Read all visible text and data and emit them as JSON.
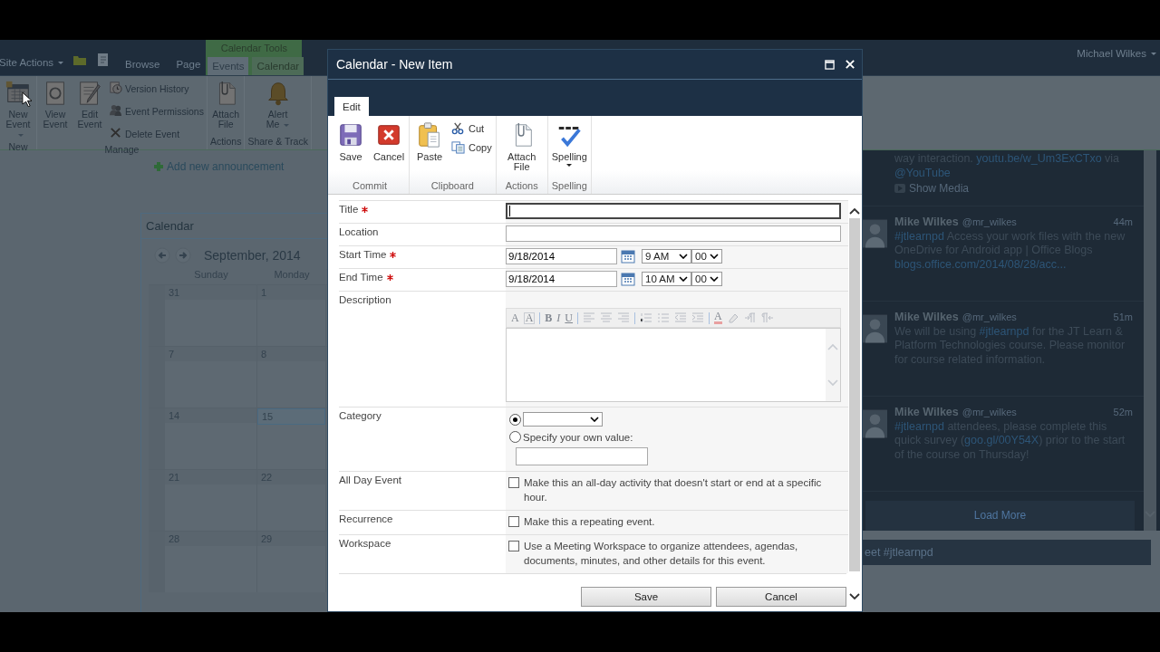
{
  "top_bar": {
    "site_actions": "Site Actions",
    "tabs": [
      {
        "label": "Browse",
        "selected": false
      },
      {
        "label": "Page",
        "selected": false
      }
    ],
    "tool_group": {
      "title": "Calendar Tools",
      "tabs": [
        {
          "label": "Events",
          "selected": true
        },
        {
          "label": "Calendar",
          "selected": false
        }
      ]
    },
    "user": "Michael Wilkes"
  },
  "page_ribbon": {
    "groups": [
      {
        "label": "New",
        "items": [
          {
            "kind": "large",
            "label": "New Event",
            "dropdown": true
          }
        ]
      },
      {
        "label": "Manage",
        "items": [
          {
            "kind": "large",
            "label": "View Event",
            "dropdown": false
          },
          {
            "kind": "large",
            "label": "Edit Event",
            "dropdown": false
          },
          {
            "kind": "stack",
            "items": [
              "Version History",
              "Event Permissions",
              "Delete Event"
            ]
          }
        ]
      },
      {
        "label": "Actions",
        "items": [
          {
            "kind": "large",
            "label": "Attach File",
            "dropdown": false
          }
        ]
      },
      {
        "label": "Share & Track",
        "items": [
          {
            "kind": "large",
            "label": "Alert Me",
            "dropdown": true
          }
        ]
      }
    ]
  },
  "content": {
    "add_link": "Add new announcement",
    "calendar": {
      "title": "Calendar",
      "month": "September, 2014",
      "days": [
        "Sunday",
        "Monday"
      ],
      "weeks": [
        [
          {
            "date": "31",
            "today": false
          },
          {
            "date": "1",
            "today": false
          }
        ],
        [
          {
            "date": "7",
            "today": false
          },
          {
            "date": "8",
            "today": false
          }
        ],
        [
          {
            "date": "14",
            "today": false
          },
          {
            "date": "15",
            "today": true
          }
        ],
        [
          {
            "date": "21",
            "today": false
          },
          {
            "date": "22",
            "today": false
          }
        ],
        [
          {
            "date": "28",
            "today": false
          },
          {
            "date": "29",
            "today": false
          }
        ]
      ]
    }
  },
  "twitter": {
    "partial_tweet": {
      "segments": [
        {
          "kind": "plain",
          "text": "way interaction. "
        },
        {
          "kind": "link",
          "text": "youtu.be/w_Um3ExCTxo"
        },
        {
          "kind": "plain",
          "text": " via "
        },
        {
          "kind": "link",
          "text": "@YouTube"
        }
      ],
      "media": "Show Media"
    },
    "tweets": [
      {
        "name": "Mike Wilkes",
        "handle": "@mr_wilkes",
        "time": "44m",
        "segments": [
          {
            "kind": "link",
            "text": "#jtlearnpd"
          },
          {
            "kind": "plain",
            "text": " Access your work files with the new OneDrive for Android app | Office Blogs "
          },
          {
            "kind": "link",
            "text": "blogs.office.com/2014/08/28/acc..."
          }
        ]
      },
      {
        "name": "Mike Wilkes",
        "handle": "@mr_wilkes",
        "time": "51m",
        "segments": [
          {
            "kind": "plain",
            "text": "We will be using "
          },
          {
            "kind": "link",
            "text": "#jtlearnpd"
          },
          {
            "kind": "plain",
            "text": " for the JT Learn & Platform Technologies course. Please monitor for course related information."
          }
        ]
      },
      {
        "name": "Mike Wilkes",
        "handle": "@mr_wilkes",
        "time": "52m",
        "segments": [
          {
            "kind": "link",
            "text": "#jtlearnpd"
          },
          {
            "kind": "plain",
            "text": " attendees, please complete this quick survey ("
          },
          {
            "kind": "link",
            "text": "goo.gl/00Y54X"
          },
          {
            "kind": "plain",
            "text": ") prior to the start of the course on Thursday!"
          }
        ]
      }
    ],
    "load_more": "Load More",
    "compose": {
      "placeholder": "eet #jtlearnpd"
    }
  },
  "dialog": {
    "title": "Calendar - New Item",
    "tabs": [
      {
        "label": "Edit",
        "selected": true
      }
    ],
    "ribbon": {
      "groups": [
        {
          "label": "Commit",
          "items": [
            {
              "kind": "large",
              "label": "Save",
              "dropdown": false
            },
            {
              "kind": "large",
              "label": "Cancel",
              "dropdown": false
            }
          ]
        },
        {
          "label": "Clipboard",
          "items": [
            {
              "kind": "large",
              "label": "Paste",
              "dropdown": false
            },
            {
              "kind": "stack",
              "items": [
                "Cut",
                "Copy"
              ]
            }
          ]
        },
        {
          "label": "Actions",
          "items": [
            {
              "kind": "large",
              "label": "Attach File",
              "dropdown": false
            }
          ]
        },
        {
          "label": "Spelling",
          "items": [
            {
              "kind": "large",
              "label": "Spelling",
              "dropdown": true
            }
          ]
        }
      ]
    },
    "fields": [
      {
        "label": "Title",
        "required": true,
        "kind": "text",
        "focused": true
      },
      {
        "label": "Location",
        "required": false,
        "kind": "text",
        "focused": false
      },
      {
        "label": "Start Time",
        "required": true,
        "kind": "datetime",
        "date": "9/18/2014",
        "hour": "9 AM",
        "minute": "00"
      },
      {
        "label": "End Time",
        "required": true,
        "kind": "datetime",
        "date": "9/18/2014",
        "hour": "10 AM",
        "minute": "00"
      },
      {
        "label": "Description",
        "required": false,
        "kind": "richtext",
        "toolbar": [
          {
            "kind": "font",
            "text": "A"
          },
          {
            "kind": "font-size",
            "text": "A"
          },
          {
            "kind": "sep"
          },
          {
            "kind": "bold",
            "text": "B"
          },
          {
            "kind": "italic",
            "text": "I"
          },
          {
            "kind": "underline",
            "text": "U"
          },
          {
            "kind": "sep"
          },
          {
            "kind": "align-left"
          },
          {
            "kind": "align-center"
          },
          {
            "kind": "align-right"
          },
          {
            "kind": "sep"
          },
          {
            "kind": "numbered-list"
          },
          {
            "kind": "bulleted-list"
          },
          {
            "kind": "outdent"
          },
          {
            "kind": "indent"
          },
          {
            "kind": "sep"
          },
          {
            "kind": "font-color",
            "text": "A"
          },
          {
            "kind": "highlight"
          },
          {
            "kind": "ltr"
          },
          {
            "kind": "rtl"
          }
        ]
      },
      {
        "label": "Category",
        "required": false,
        "kind": "choice",
        "options": [
          {
            "kind": "dropdown",
            "selected": true
          },
          {
            "kind": "custom",
            "label": "Specify your own value:",
            "selected": false
          }
        ]
      },
      {
        "label": "All Day Event",
        "required": false,
        "kind": "checkbox",
        "checked": false,
        "text": "Make this an all-day activity that doesn't start or end at a specific hour."
      },
      {
        "label": "Recurrence",
        "required": false,
        "kind": "checkbox",
        "checked": false,
        "text": "Make this a repeating event."
      },
      {
        "label": "Workspace",
        "required": false,
        "kind": "checkbox",
        "checked": false,
        "text": "Use a Meeting Workspace to organize attendees, agendas, documents, minutes, and other details for this event."
      }
    ],
    "buttons": [
      "Save",
      "Cancel"
    ]
  }
}
